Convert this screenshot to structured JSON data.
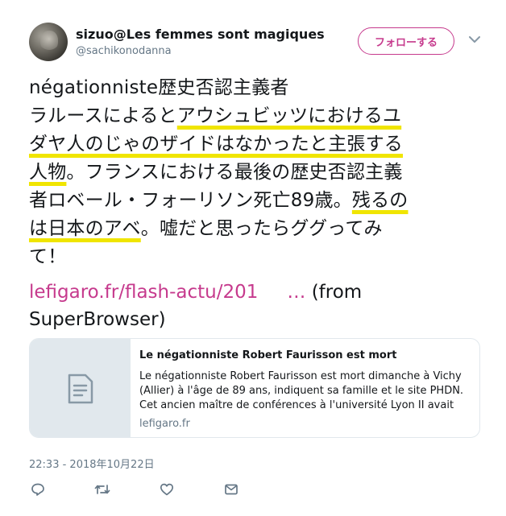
{
  "user": {
    "display_name": "sizuo@Les femmes sont magiques",
    "handle": "@sachikonodanna"
  },
  "follow_button": {
    "label": "フォローする"
  },
  "tweet": {
    "lines": [
      [
        {
          "t": "négationniste歴史否認主義者",
          "h": false
        }
      ],
      [
        {
          "t": "ラルースによると",
          "h": false
        },
        {
          "t": "アウシュビッツにおけるユ",
          "h": true
        }
      ],
      [
        {
          "t": "ダヤ人のじゃのザイドはなかったと主張する",
          "h": true
        }
      ],
      [
        {
          "t": "人物",
          "h": true
        },
        {
          "t": "。フランスにおける最後の歴史否認主義",
          "h": false
        }
      ],
      [
        {
          "t": "者ロベール・フォーリソン死亡89歳。",
          "h": false
        },
        {
          "t": "残るの",
          "h": true
        }
      ],
      [
        {
          "t": "は日本のアベ",
          "h": true
        },
        {
          "t": "。嘘だと思ったらググってみ",
          "h": false
        }
      ],
      [
        {
          "t": "て！",
          "h": false
        }
      ]
    ],
    "link_text": "lefigaro.fr/flash-actu/201",
    "ellipsis": "…",
    "from_line_1": " (from",
    "from_line_2": "SuperBrowser)"
  },
  "card": {
    "title": "Le négationniste Robert Faurisson est mort",
    "description": "Le négationniste Robert Faurisson est mort dimanche à Vichy (Allier) à l'âge de 89 ans, indiquent sa famille et le site PHDN. Cet ancien maître de conférences à l'université Lyon II avait été...",
    "domain": "lefigaro.fr"
  },
  "timestamp": "22:33 - 2018年10月22日",
  "icons": {
    "reply": "reply-icon",
    "retweet": "retweet-icon",
    "like": "heart-icon",
    "dm": "envelope-icon",
    "caret": "chevron-down-icon",
    "card": "document-icon"
  },
  "colors": {
    "accent": "#c63a8d",
    "highlight": "#f0e500",
    "muted": "#657786",
    "text": "#14171a",
    "border": "#e1e8ed"
  }
}
